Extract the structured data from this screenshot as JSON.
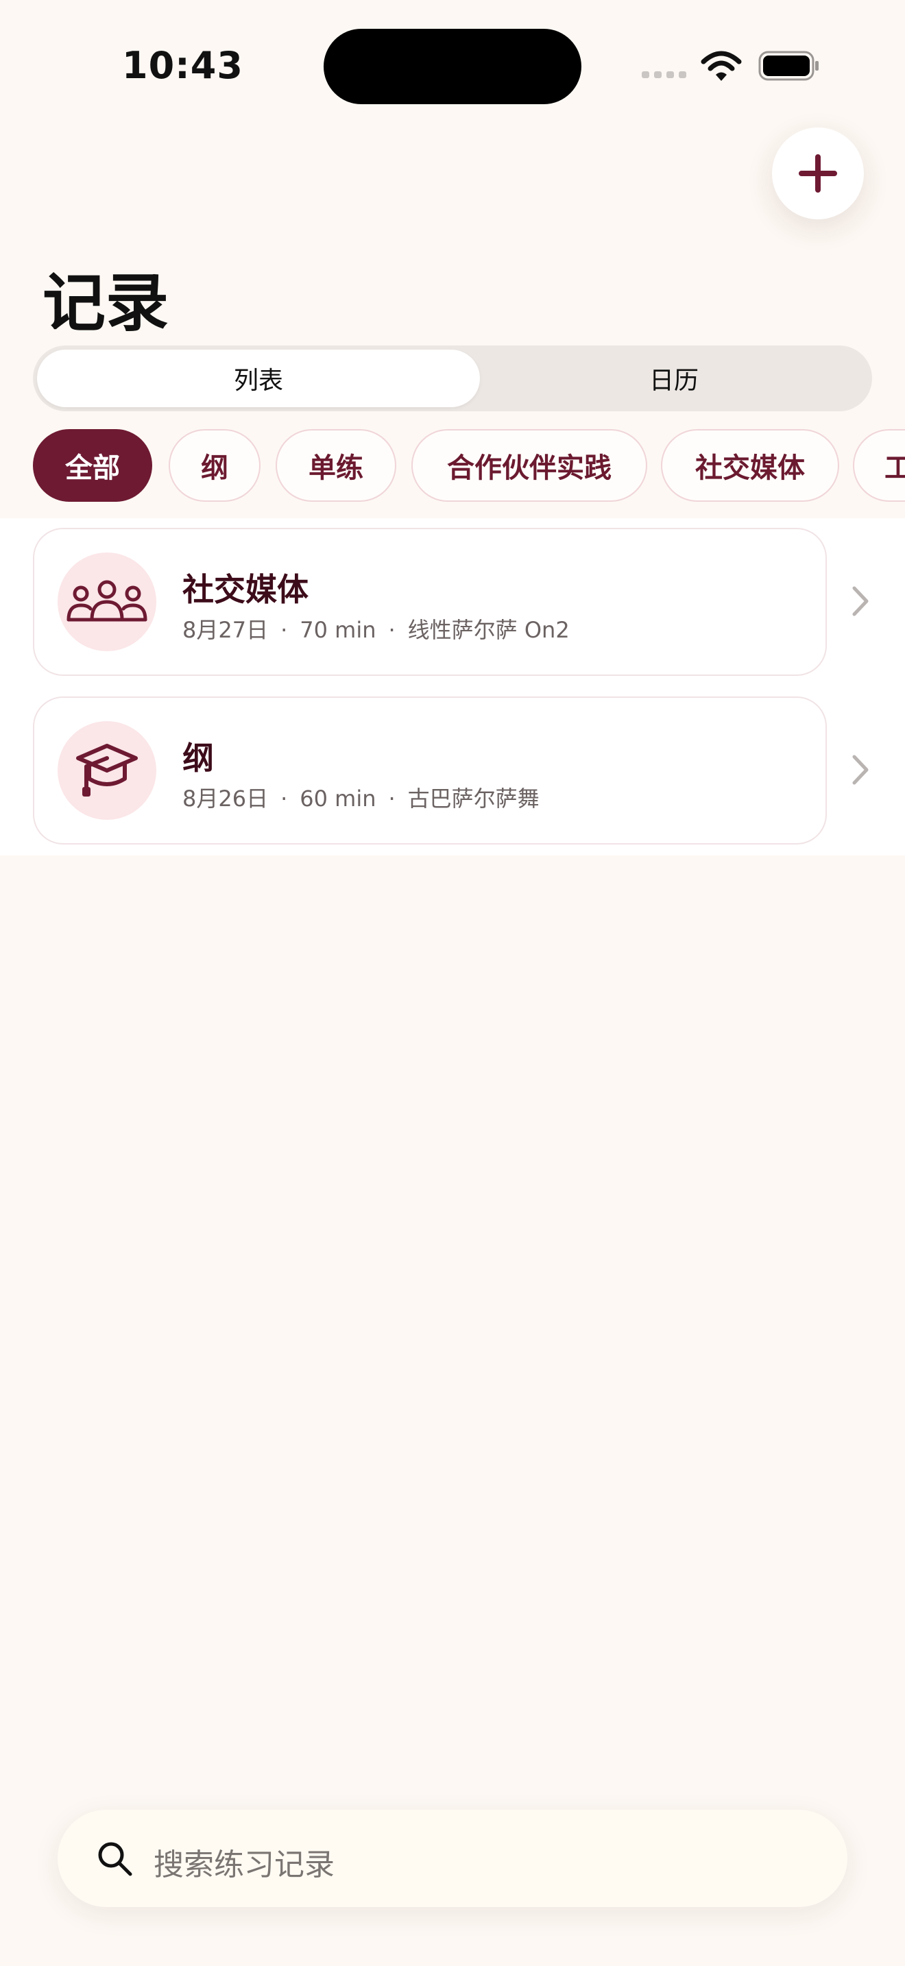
{
  "status_bar": {
    "time": "10:43"
  },
  "header": {
    "title": "记录",
    "add_icon": "plus-icon"
  },
  "view_toggle": {
    "options": [
      "列表",
      "日历"
    ],
    "selected": "列表"
  },
  "filters": {
    "chips": [
      "全部",
      "纲",
      "单练",
      "合作伙伴实践",
      "社交媒体",
      "工"
    ],
    "selected": "全部"
  },
  "records": [
    {
      "title": "社交媒体",
      "date": "8月27日",
      "duration": "70 min",
      "style": "线性萨尔萨 On2",
      "icon": "people-group-icon"
    },
    {
      "title": "纲",
      "date": "8月26日",
      "duration": "60 min",
      "style": "古巴萨尔萨舞",
      "icon": "graduation-cap-icon"
    }
  ],
  "meta_separator": "·",
  "search": {
    "placeholder": "搜索练习记录"
  },
  "colors": {
    "accent": "#6e1a33",
    "background": "#fdf8f3",
    "chip_border": "#f0d5d9",
    "icon_bg": "#fbe6e8"
  }
}
